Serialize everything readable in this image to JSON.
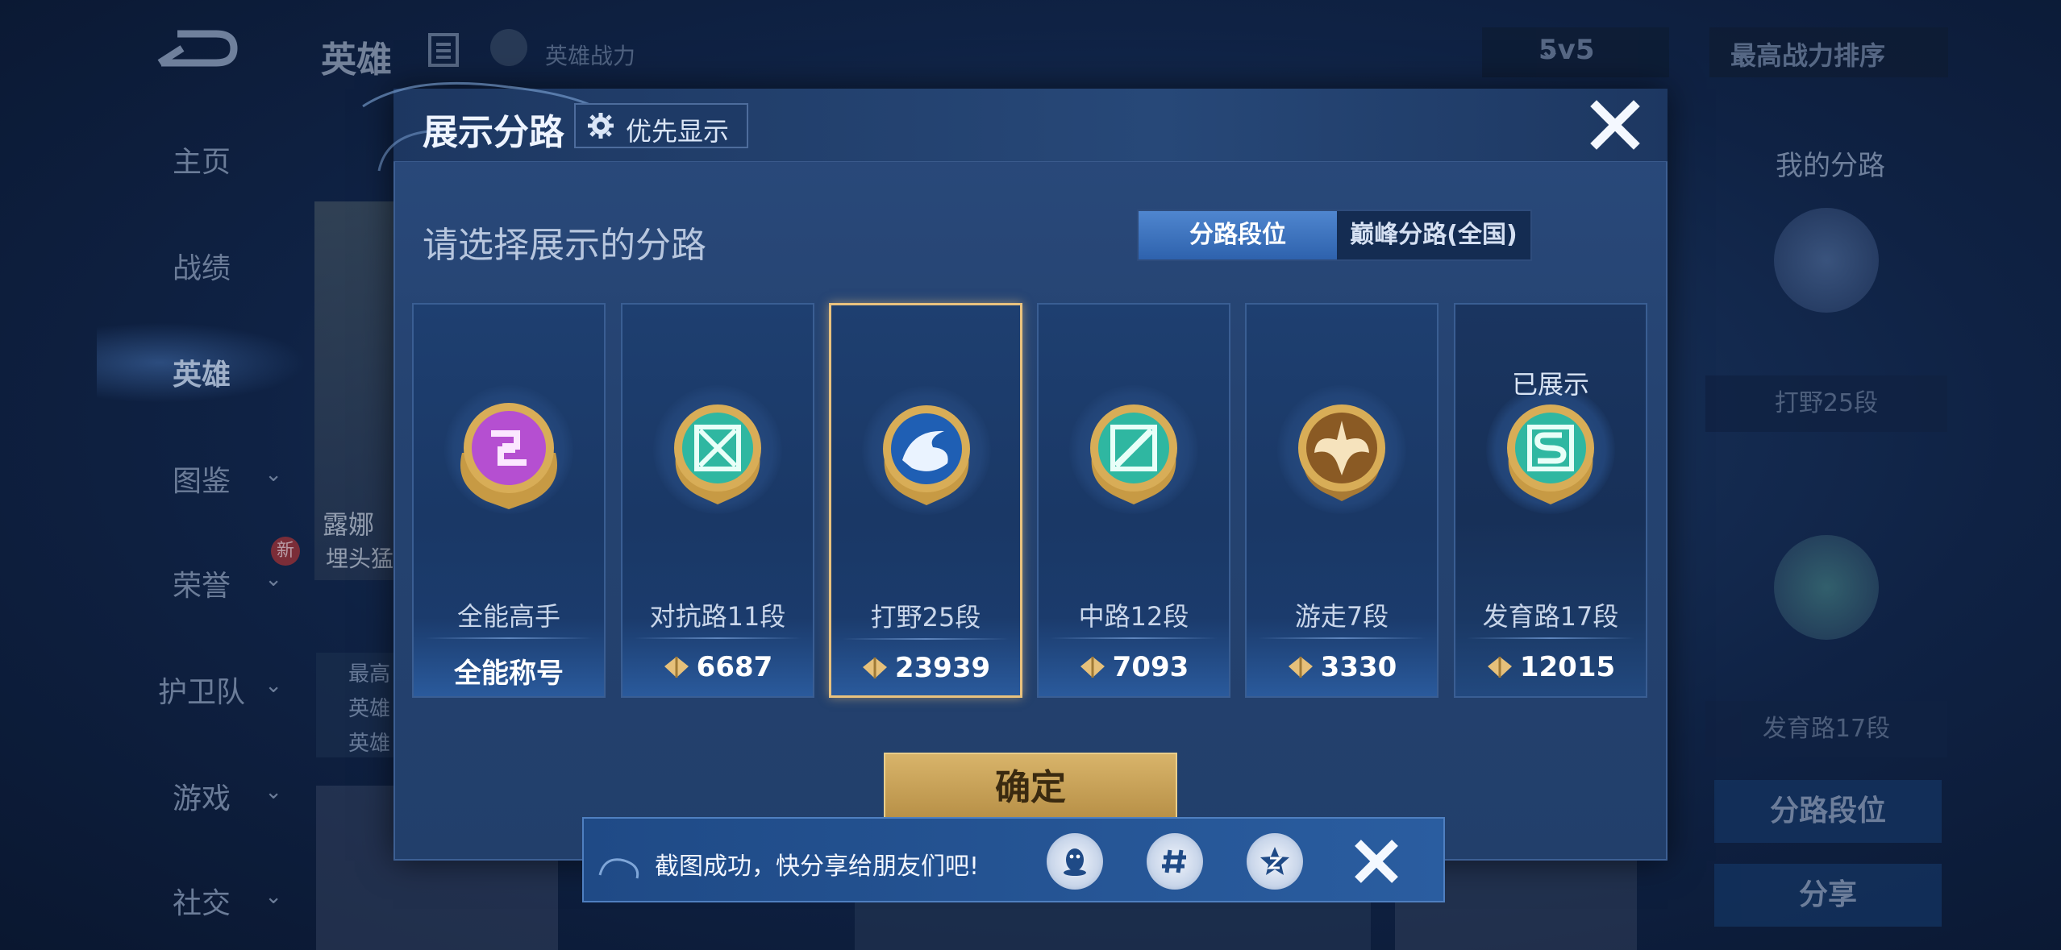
{
  "background": {
    "page_title": "英雄",
    "hero_power_label": "英雄战力",
    "mode_select": "5v5",
    "sort_select": "最高战力排序",
    "sidebar": [
      "主页",
      "战绩",
      "英雄",
      "图鉴",
      "荣誉",
      "护卫队",
      "游戏",
      "社交"
    ],
    "new_badge": "新",
    "hero_card_name": "露娜",
    "hero_card_sub": "埋头猛",
    "hero_info": [
      "最高",
      "英雄",
      "英雄"
    ],
    "right_panel": {
      "title": "我的分路",
      "label1": "打野25段",
      "label2": "发育路17段",
      "button1": "分路段位",
      "button2": "分享"
    }
  },
  "modal": {
    "title": "展示分路",
    "priority_button": "优先显示",
    "prompt": "请选择展示的分路",
    "tabs": [
      "分路段位",
      "巅峰分路(全国)"
    ],
    "cards": [
      {
        "name": "全能高手",
        "score": "全能称号",
        "shown": "",
        "badge": "purple"
      },
      {
        "name": "对抗路11段",
        "score": "6687",
        "shown": "",
        "badge": "teal-cross"
      },
      {
        "name": "打野25段",
        "score": "23939",
        "shown": "",
        "badge": "blue-dragon"
      },
      {
        "name": "中路12段",
        "score": "7093",
        "shown": "",
        "badge": "teal-slash"
      },
      {
        "name": "游走7段",
        "score": "3330",
        "shown": "",
        "badge": "gold-wing"
      },
      {
        "name": "发育路17段",
        "score": "12015",
        "shown": "已展示",
        "badge": "teal-s"
      }
    ],
    "selected_index": 2,
    "confirm": "确定"
  },
  "toast": {
    "message": "截图成功，快分享给朋友们吧!",
    "share_icons": [
      "qq-icon",
      "wechat-moments-icon",
      "qzone-icon"
    ]
  }
}
